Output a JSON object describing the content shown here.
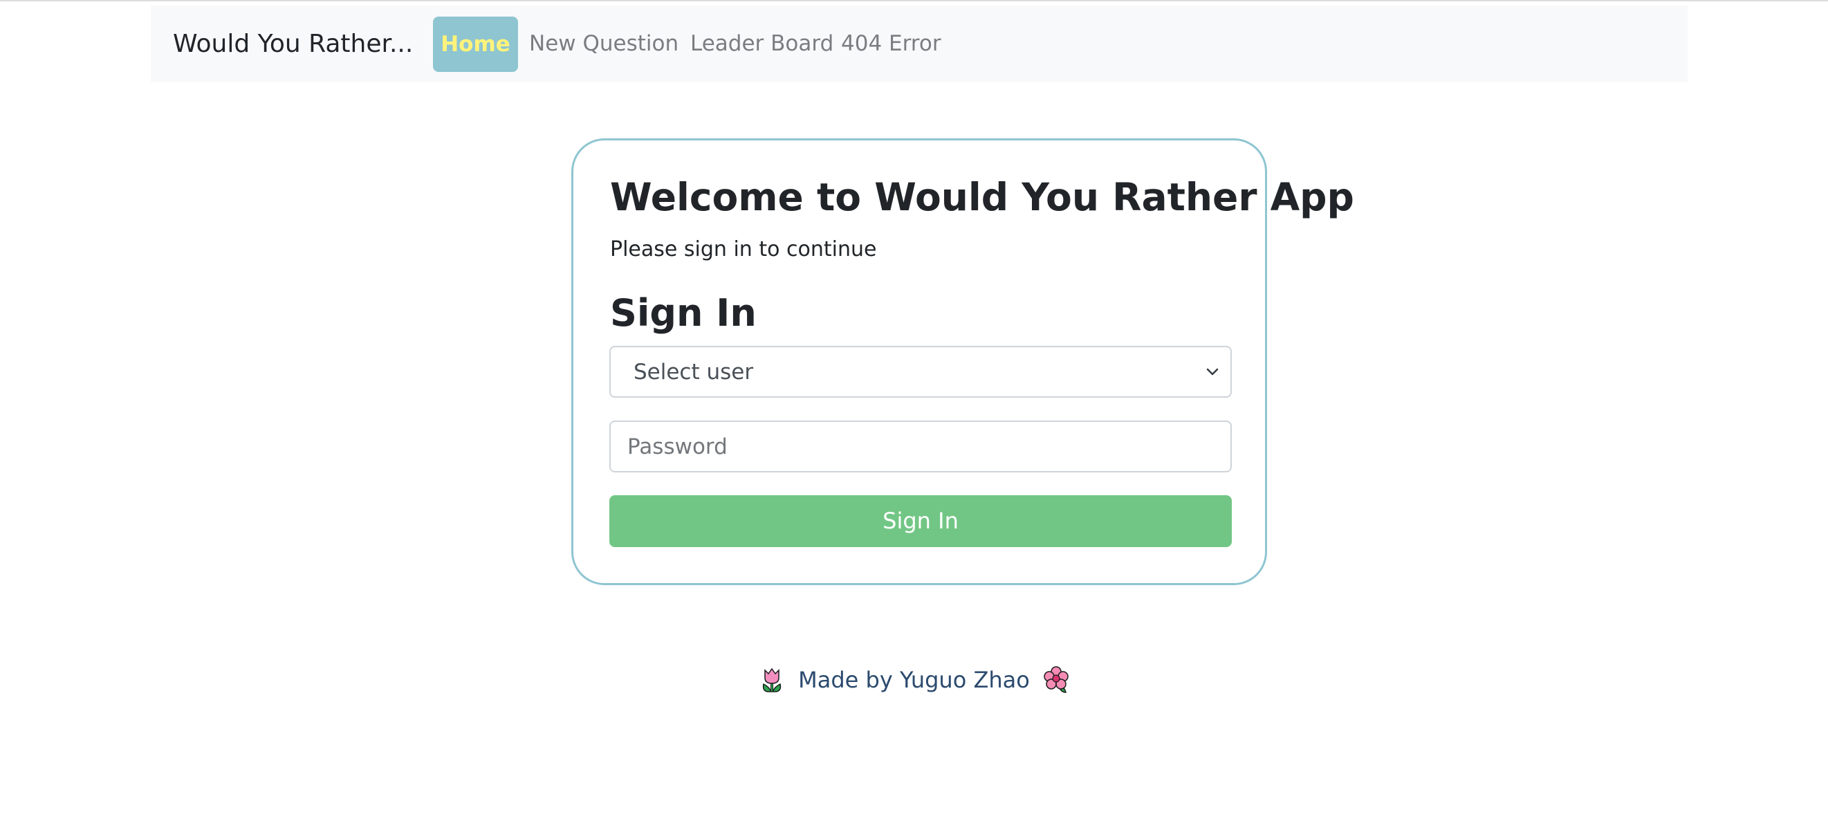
{
  "navbar": {
    "brand": "Would You Rather...",
    "items": [
      {
        "label": "Home",
        "active": true
      },
      {
        "label": "New Question",
        "active": false
      },
      {
        "label": "Leader Board",
        "active": false
      },
      {
        "label": "404 Error",
        "active": false
      }
    ]
  },
  "card": {
    "title": "Welcome to Would You Rather App",
    "subtitle": "Please sign in to continue",
    "heading": "Sign In",
    "user_select": {
      "selected": "Select user",
      "icon": "chevron-down-icon"
    },
    "password": {
      "placeholder": "Password",
      "value": ""
    },
    "submit_label": "Sign In"
  },
  "footer": {
    "text": "Made by Yuguo Zhao",
    "left_icon": "tulip-icon",
    "right_icon": "hibiscus-icon"
  },
  "colors": {
    "accent": "#8ec5d1",
    "active_nav_text": "#fff37a",
    "button_green": "#72c685",
    "footer_text": "#2b4a6e",
    "navbar_bg": "#f8f9fa"
  }
}
